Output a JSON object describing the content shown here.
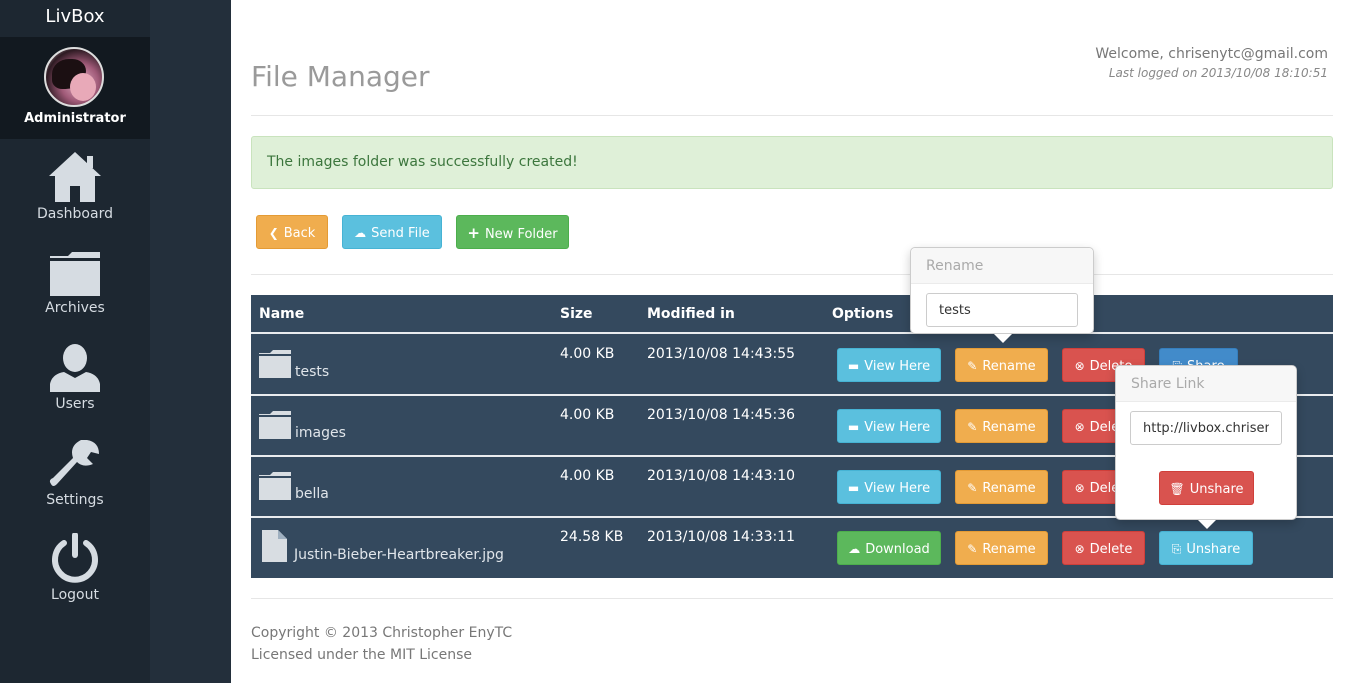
{
  "brand": "LivBox",
  "user": {
    "role": "Administrator"
  },
  "nav": [
    {
      "label": "Dashboard",
      "icon": "home-icon"
    },
    {
      "label": "Archives",
      "icon": "folder-icon"
    },
    {
      "label": "Users",
      "icon": "user-icon"
    },
    {
      "label": "Settings",
      "icon": "wrench-icon"
    },
    {
      "label": "Logout",
      "icon": "power-icon"
    }
  ],
  "header": {
    "title": "File Manager",
    "welcome": "Welcome, chrisenytc@gmail.com",
    "last_logged": "Last logged on 2013/10/08 18:10:51"
  },
  "alert": "The images folder was successfully created!",
  "toolbar": {
    "back": "Back",
    "send_file": "Send File",
    "new_folder": "New Folder"
  },
  "table": {
    "columns": [
      "Name",
      "Size",
      "Modified in",
      "Options"
    ],
    "rows": [
      {
        "name": "tests",
        "type": "folder",
        "size": "4.00 KB",
        "modified": "2013/10/08 14:43:55",
        "primary": "View Here",
        "rename": "Rename",
        "delete": "Delete",
        "share": "Share"
      },
      {
        "name": "images",
        "type": "folder",
        "size": "4.00 KB",
        "modified": "2013/10/08 14:45:36",
        "primary": "View Here",
        "rename": "Rename",
        "delete": "Delete"
      },
      {
        "name": "bella",
        "type": "folder",
        "size": "4.00 KB",
        "modified": "2013/10/08 14:43:10",
        "primary": "View Here",
        "rename": "Rename",
        "delete": "Delete"
      },
      {
        "name": "Justin-Bieber-Heartbreaker.jpg",
        "type": "file",
        "size": "24.58 KB",
        "modified": "2013/10/08 14:33:11",
        "primary": "Download",
        "rename": "Rename",
        "delete": "Delete",
        "share": "Unshare"
      }
    ]
  },
  "rename_popover": {
    "title": "Rename",
    "value": "tests"
  },
  "share_popover": {
    "title": "Share Link",
    "value": "http://livbox.chriseny",
    "button": "Unshare"
  },
  "footer": {
    "copyright": "Copyright © 2013 Christopher EnyTC",
    "license": "Licensed under the MIT License"
  },
  "colors": {
    "sidebar": "#1d2731",
    "table": "#34495e",
    "warning": "#f0ad4e",
    "info": "#5bc0de",
    "success": "#5cb85c",
    "danger": "#d9534f"
  }
}
